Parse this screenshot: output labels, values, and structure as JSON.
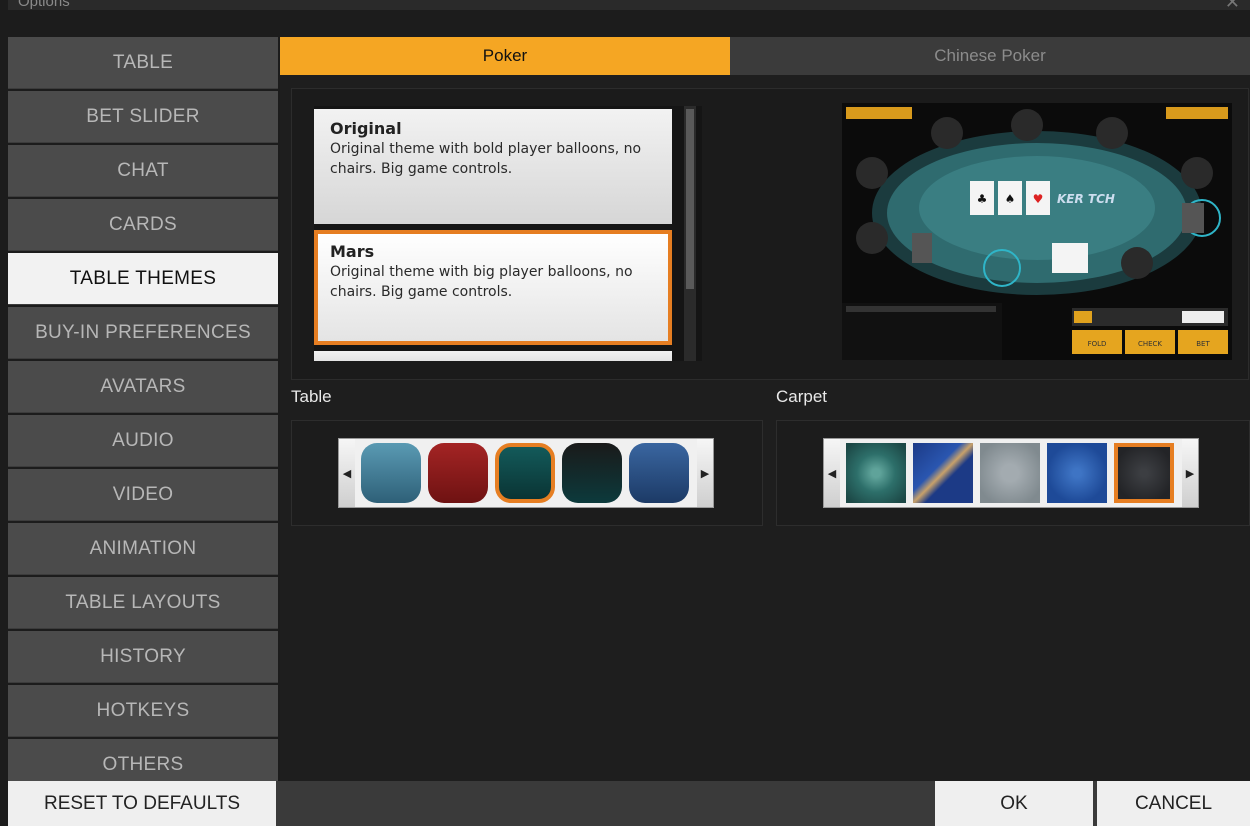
{
  "window": {
    "title": "Options",
    "close_icon": "close-icon"
  },
  "sidebar": {
    "items": [
      {
        "label": "TABLE"
      },
      {
        "label": "BET SLIDER"
      },
      {
        "label": "CHAT"
      },
      {
        "label": "CARDS"
      },
      {
        "label": "TABLE THEMES",
        "active": true
      },
      {
        "label": "BUY-IN PREFERENCES"
      },
      {
        "label": "AVATARS"
      },
      {
        "label": "AUDIO"
      },
      {
        "label": "VIDEO"
      },
      {
        "label": "ANIMATION"
      },
      {
        "label": "TABLE LAYOUTS"
      },
      {
        "label": "HISTORY"
      },
      {
        "label": "HOTKEYS"
      },
      {
        "label": "OTHERS"
      }
    ]
  },
  "tabs": [
    {
      "label": "Poker",
      "active": true
    },
    {
      "label": "Chinese Poker",
      "active": false
    }
  ],
  "themes": [
    {
      "name": "Original",
      "description": "Original theme with bold player balloons, no chairs. Big game controls.",
      "selected": false
    },
    {
      "name": "Mars",
      "description": "Original theme with big player balloons, no chairs. Big game controls.",
      "selected": true
    }
  ],
  "preview": {
    "buttons": [
      "FOLD",
      "CHECK",
      "BET"
    ],
    "logo_text": "KER TCH"
  },
  "table_section": {
    "label": "Table",
    "swatches": [
      "#3f7a94",
      "#8a1c1c",
      "#0f4a4a",
      "#151515",
      "#2d5585"
    ],
    "selected_index": 2
  },
  "carpet_section": {
    "label": "Carpet",
    "carpets": [
      "#2f6f6a",
      "#1e3f86",
      "#8a9296",
      "#2a5aa8",
      "#2b2d30"
    ],
    "selected_index": 4
  },
  "footer": {
    "reset_label": "RESET TO DEFAULTS",
    "ok_label": "OK",
    "cancel_label": "CANCEL"
  },
  "colors": {
    "accent": "#f5a623",
    "selection": "#e67e22"
  }
}
